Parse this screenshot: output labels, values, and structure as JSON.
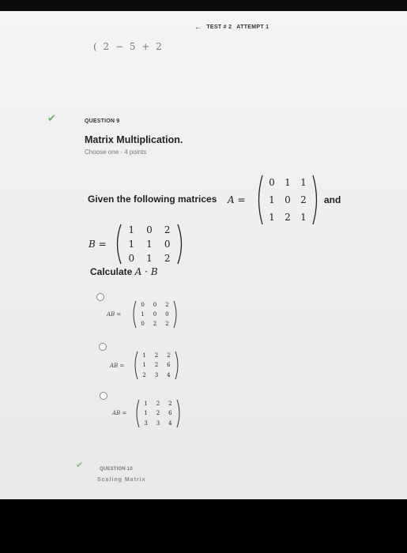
{
  "header": {
    "arrow": "←",
    "test_label": "TEST # 2",
    "attempt_label": "ATTEMPT 1"
  },
  "previous_cutoff": "( 2 − 5 + 2",
  "question": {
    "number_label": "QUESTION 9",
    "title": "Matrix Multiplication.",
    "meta": "Choose one · 4 points",
    "given_text": "Given the following matrices",
    "matrix_a_label": "A =",
    "matrix_a": [
      [
        "0",
        "1",
        "1"
      ],
      [
        "1",
        "0",
        "2"
      ],
      [
        "1",
        "2",
        "1"
      ]
    ],
    "and_text": "and",
    "matrix_b_label": "B =",
    "matrix_b": [
      [
        "1",
        "0",
        "2"
      ],
      [
        "1",
        "1",
        "0"
      ],
      [
        "0",
        "1",
        "2"
      ]
    ],
    "calculate_text": "Calculate",
    "calculate_expr": "A · B"
  },
  "options": [
    {
      "label": "AB =",
      "matrix": [
        [
          "0",
          "0",
          "2"
        ],
        [
          "1",
          "0",
          "0"
        ],
        [
          "0",
          "2",
          "2"
        ]
      ]
    },
    {
      "label": "AB =",
      "matrix": [
        [
          "1",
          "2",
          "2"
        ],
        [
          "1",
          "2",
          "6"
        ],
        [
          "2",
          "3",
          "4"
        ]
      ]
    },
    {
      "label": "AB =",
      "matrix": [
        [
          "1",
          "2",
          "2"
        ],
        [
          "1",
          "2",
          "6"
        ],
        [
          "3",
          "3",
          "4"
        ]
      ]
    }
  ],
  "next_question": {
    "number_label": "QUESTION 10",
    "title_fragment": "Scaling Matrix"
  },
  "colors": {
    "check": "#6bb26b",
    "background": "#f0f0f0",
    "bezel": "#000000"
  }
}
